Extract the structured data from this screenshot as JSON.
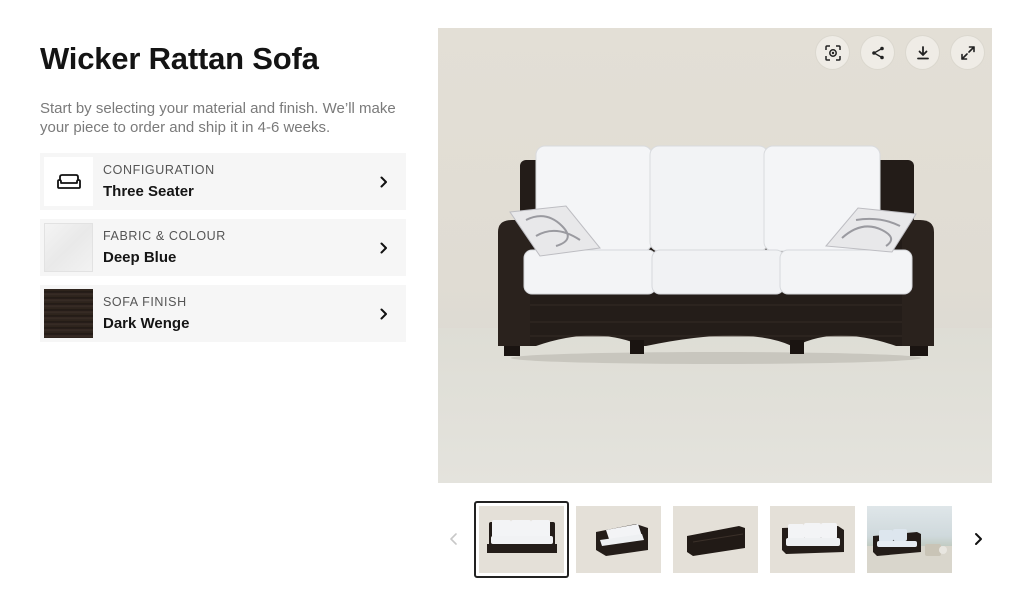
{
  "product": {
    "title": "Wicker Rattan Sofa",
    "subtitle": "Start by selecting your material and finish. We’ll make your piece to order and ship it in 4-6 weeks."
  },
  "options": [
    {
      "label": "CONFIGURATION",
      "value": "Three Seater",
      "thumb_icon": "sofa-icon"
    },
    {
      "label": "FABRIC & COLOUR",
      "value": "Deep Blue",
      "thumb_icon": "fabric-swatch"
    },
    {
      "label": "SOFA FINISH",
      "value": "Dark Wenge",
      "thumb_icon": "wood-swatch"
    }
  ],
  "viewer": {
    "tools": [
      "ar-view-icon",
      "share-icon",
      "download-icon",
      "expand-icon"
    ]
  },
  "gallery": {
    "selected_index": 0,
    "thumbnails": [
      "front-view",
      "angled-view",
      "back-view",
      "side-angled-view",
      "outdoor-scene"
    ]
  },
  "colors": {
    "wicker": "#241d19",
    "cushion": "#f3f4f6",
    "background": "#e3dfd6",
    "selected_border": "#222222"
  }
}
